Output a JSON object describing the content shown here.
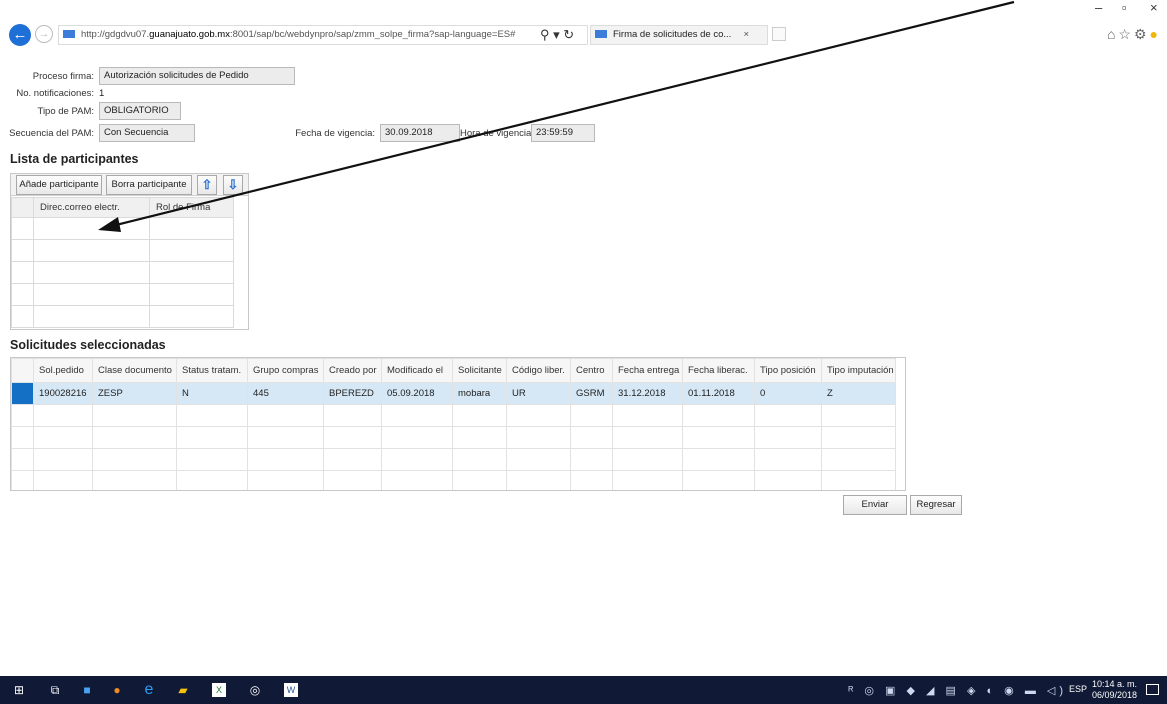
{
  "browser": {
    "url_prefix": "http://gdgdvu07.",
    "url_domain": "guanajuato.gob.mx",
    "url_rest": ":8001/sap/bc/webdynpro/sap/zmm_solpe_firma?sap-language=ES#",
    "tab_title": "Firma de solicitudes de co...",
    "tab_close": "×",
    "search_icon": "⚲ ▾ ↻"
  },
  "form": {
    "proceso_label": "Proceso firma:",
    "proceso_value": "Autorización solicitudes de Pedido",
    "notif_label": "No. notificaciones:",
    "notif_value": "1",
    "tipo_label": "Tipo de PAM:",
    "tipo_value": "OBLIGATORIO",
    "secuencia_label": "Secuencia del PAM:",
    "secuencia_value": "Con Secuencia",
    "fecha_label": "Fecha de vigencia:",
    "fecha_value": "30.09.2018",
    "hora_label": "Hora de vigencia:",
    "hora_value": "23:59:59"
  },
  "participants": {
    "title": "Lista de participantes",
    "add_button": "Añade participante",
    "delete_button": "Borra participante",
    "columns": [
      "Direc.correo electr.",
      "Rol de Firma"
    ]
  },
  "requests": {
    "title": "Solicitudes seleccionadas",
    "columns": [
      "Sol.pedido",
      "Clase documento",
      "Status tratam.",
      "Grupo compras",
      "Creado por",
      "Modificado el",
      "Solicitante",
      "Código liber.",
      "Centro",
      "Fecha entrega",
      "Fecha liberac.",
      "Tipo posición",
      "Tipo imputación"
    ],
    "rows": [
      [
        "190028216",
        "ZESP",
        "N",
        "445",
        "BPEREZD",
        "05.09.2018",
        "mobara",
        "UR",
        "GSRM",
        "31.12.2018",
        "01.11.2018",
        "0",
        "Z"
      ]
    ]
  },
  "actions": {
    "send": "Enviar",
    "back": "Regresar"
  },
  "taskbar": {
    "language": "ESP",
    "time": "10:14 a. m.",
    "date": "06/09/2018"
  },
  "colors": {
    "selected_row": "#d6e8f6",
    "row_marker": "#1470c4",
    "taskbar": "#101935"
  }
}
